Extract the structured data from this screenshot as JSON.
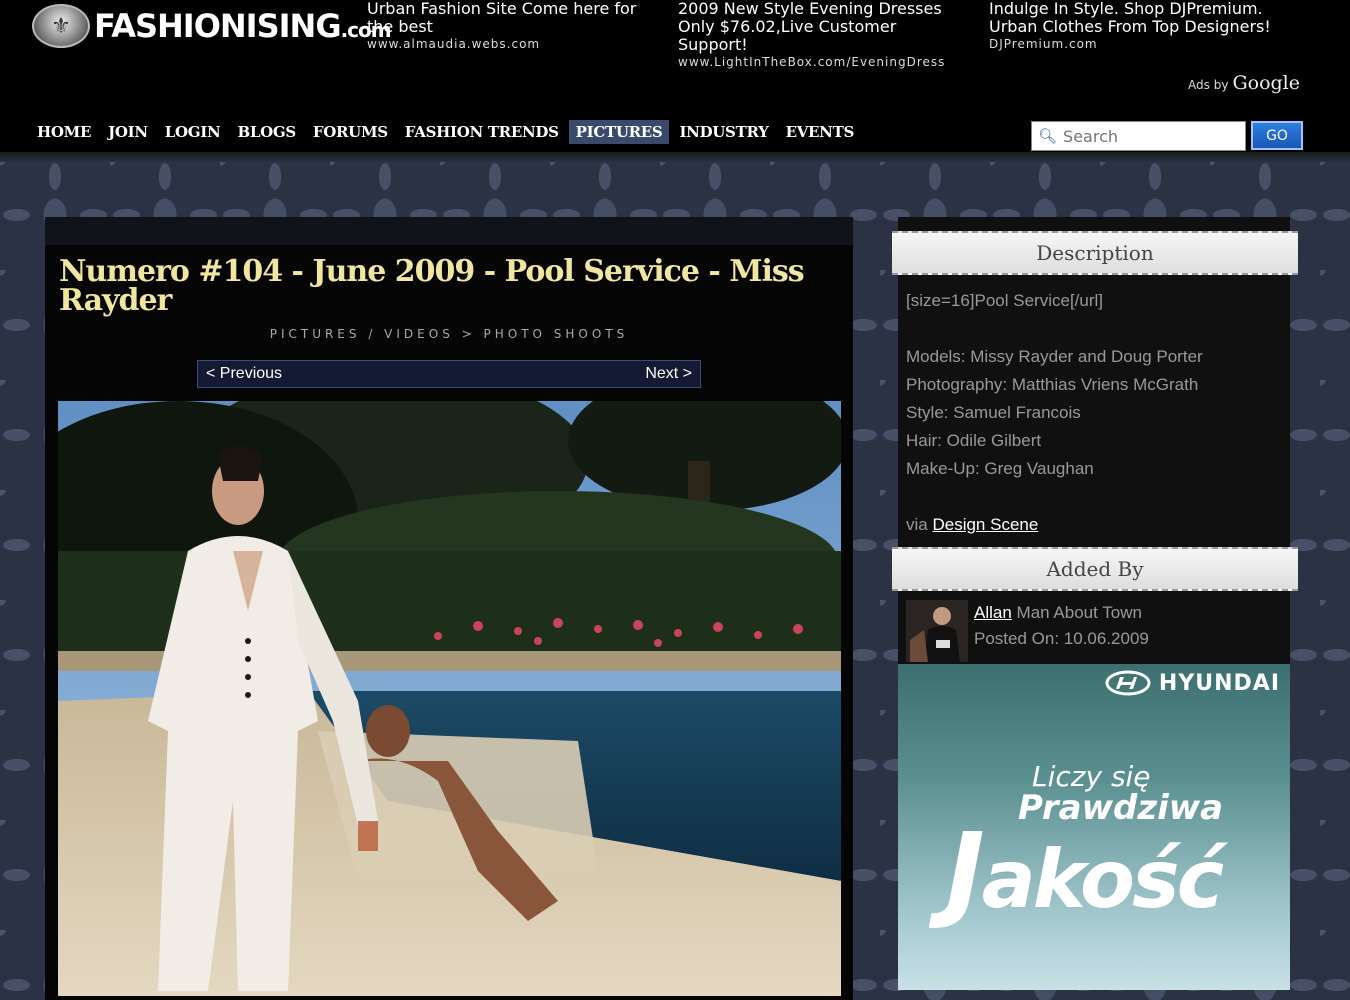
{
  "header": {
    "logo_text": "FASHIONISING",
    "logo_suffix": ".com",
    "ads": [
      {
        "title": "Urban Fashion Site Come here for the best",
        "url": "www.almaudia.webs.com"
      },
      {
        "title": "2009 New Style Evening Dresses Only $76.02,Live Customer Support!",
        "url": "www.LightInTheBox.com/EveningDress"
      },
      {
        "title": "Indulge In Style. Shop DJPremium. Urban Clothes From Top Designers!",
        "url": "DJPremium.com"
      }
    ],
    "ads_by": "Ads by",
    "ads_google": "Google"
  },
  "nav": {
    "items": [
      "HOME",
      "JOIN",
      "LOGIN",
      "BLOGS",
      "FORUMS",
      "FASHION TRENDS",
      "PICTURES",
      "INDUSTRY",
      "EVENTS"
    ],
    "active": "PICTURES"
  },
  "search": {
    "placeholder": "Search",
    "go_label": "GO"
  },
  "main": {
    "title": "Numero #104 - June 2009 - Pool Service - Miss Rayder",
    "breadcrumb": "PICTURES / VIDEOS > PHOTO SHOOTS",
    "prev_label": "< Previous",
    "next_label": "Next >"
  },
  "sidebar": {
    "description_header": "Description",
    "description_lines": [
      "[size=16]Pool Service[/url]",
      "",
      "Models: Missy Rayder and Doug Porter",
      "Photography: Matthias Vriens McGrath",
      "Style: Samuel Francois",
      "Hair: Odile Gilbert",
      "Make-Up: Greg Vaughan",
      ""
    ],
    "via_label": "via",
    "via_link": "Design Scene",
    "added_header": "Added By",
    "user_name": "Allan",
    "user_title": "Man About Town",
    "posted_on": "Posted On: 10.06.2009"
  },
  "ad_banner": {
    "brand": "HYUNDAI",
    "line1": "Liczy się",
    "line2": "Prawdziwa",
    "line3_first": "J",
    "line3_rest": "akość"
  }
}
